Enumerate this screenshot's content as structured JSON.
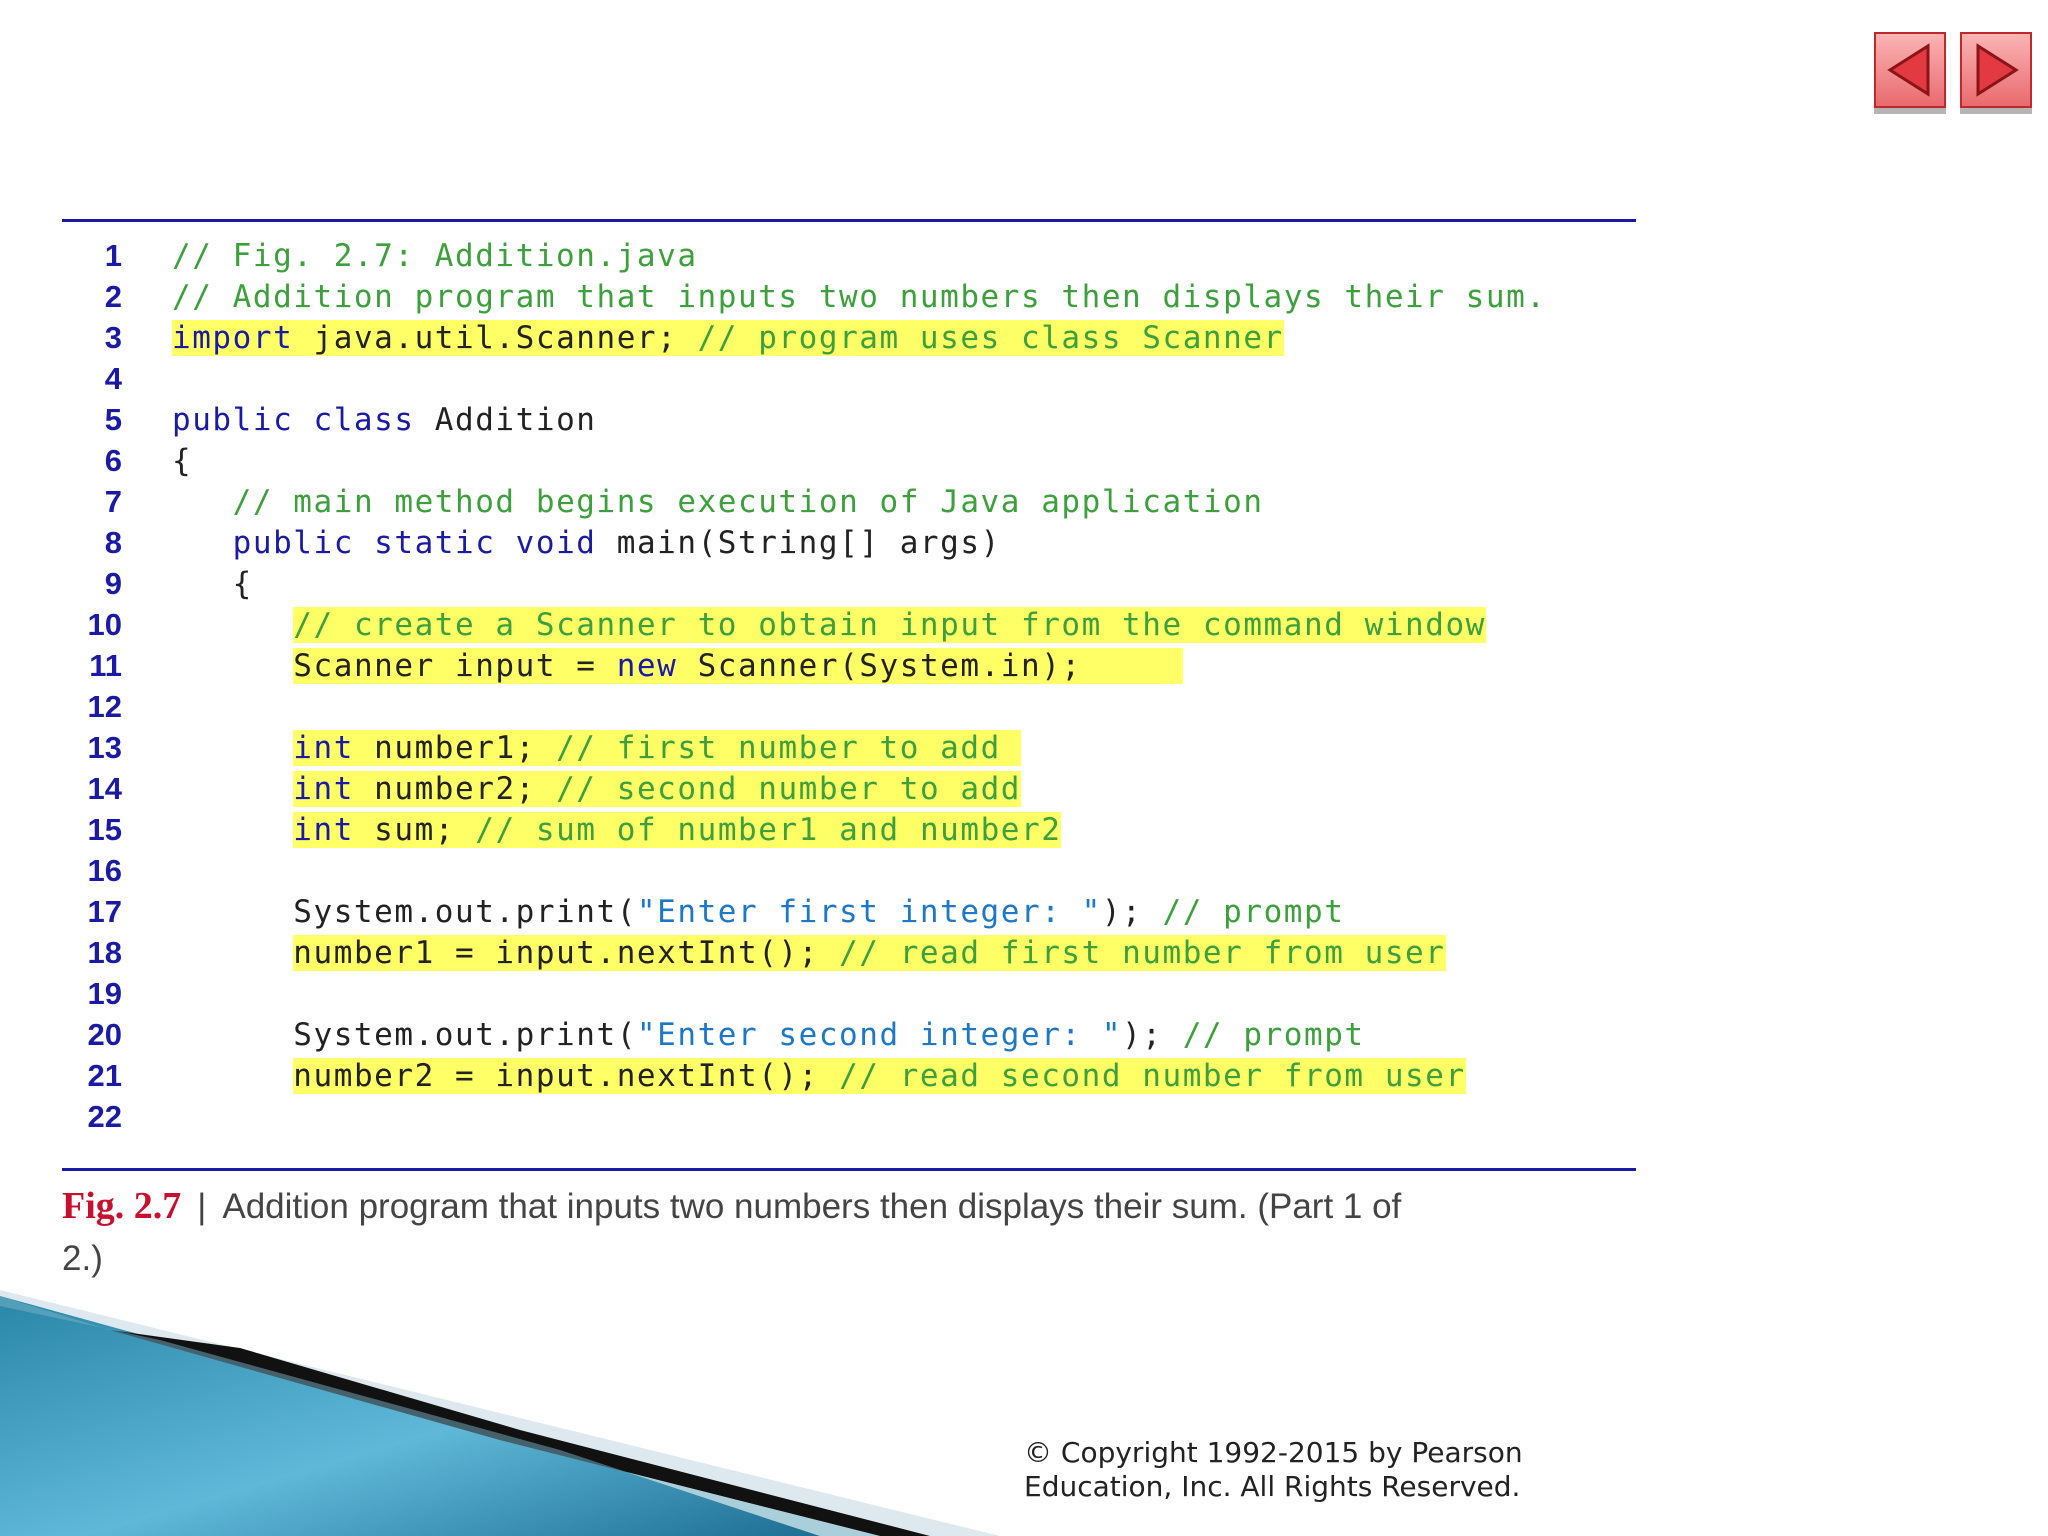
{
  "navigation": {
    "prev_icon": "triangle-left-icon",
    "next_icon": "triangle-right-icon",
    "button_color": "#f08a8d"
  },
  "code": {
    "lines": [
      {
        "n": "1",
        "segs": [
          {
            "t": "// Fig. 2.7: Addition.java",
            "c": "cm"
          }
        ]
      },
      {
        "n": "2",
        "segs": [
          {
            "t": "// Addition program that inputs two numbers then displays their sum.",
            "c": "cm"
          }
        ]
      },
      {
        "n": "3",
        "segs": [
          {
            "t": "import",
            "c": "kw",
            "h": 1
          },
          {
            "t": " java.util.Scanner; ",
            "c": "pl",
            "h": 1
          },
          {
            "t": "// program uses class Scanner",
            "c": "cm",
            "h": 1
          }
        ]
      },
      {
        "n": "4",
        "segs": []
      },
      {
        "n": "5",
        "segs": [
          {
            "t": "public class",
            "c": "kw"
          },
          {
            "t": " Addition",
            "c": "pl"
          }
        ]
      },
      {
        "n": "6",
        "segs": [
          {
            "t": "{",
            "c": "pl"
          }
        ]
      },
      {
        "n": "7",
        "segs": [
          {
            "t": "   ",
            "c": "pl"
          },
          {
            "t": "// main method begins execution of Java application",
            "c": "cm"
          }
        ]
      },
      {
        "n": "8",
        "segs": [
          {
            "t": "   ",
            "c": "pl"
          },
          {
            "t": "public static void",
            "c": "kw"
          },
          {
            "t": " main(String[] args)",
            "c": "pl"
          }
        ]
      },
      {
        "n": "9",
        "segs": [
          {
            "t": "   {",
            "c": "pl"
          }
        ]
      },
      {
        "n": "10",
        "segs": [
          {
            "t": "      ",
            "c": "pl"
          },
          {
            "t": "// create a Scanner to obtain input from the command window",
            "c": "cm",
            "h": 1
          }
        ]
      },
      {
        "n": "11",
        "segs": [
          {
            "t": "      ",
            "c": "pl"
          },
          {
            "t": "Scanner input = ",
            "c": "pl",
            "h": 1
          },
          {
            "t": "new",
            "c": "kw",
            "h": 1
          },
          {
            "t": " Scanner(System.in);     ",
            "c": "pl",
            "h": 1
          }
        ]
      },
      {
        "n": "12",
        "segs": []
      },
      {
        "n": "13",
        "segs": [
          {
            "t": "      ",
            "c": "pl"
          },
          {
            "t": "int",
            "c": "kw",
            "h": 1
          },
          {
            "t": " number1; ",
            "c": "pl",
            "h": 1
          },
          {
            "t": "// first number to add ",
            "c": "cm",
            "h": 1
          }
        ]
      },
      {
        "n": "14",
        "segs": [
          {
            "t": "      ",
            "c": "pl"
          },
          {
            "t": "int",
            "c": "kw",
            "h": 1
          },
          {
            "t": " number2; ",
            "c": "pl",
            "h": 1
          },
          {
            "t": "// second number to add",
            "c": "cm",
            "h": 1
          }
        ]
      },
      {
        "n": "15",
        "segs": [
          {
            "t": "      ",
            "c": "pl"
          },
          {
            "t": "int",
            "c": "kw",
            "h": 1
          },
          {
            "t": " sum; ",
            "c": "pl",
            "h": 1
          },
          {
            "t": "// sum of number1 and number2",
            "c": "cm",
            "h": 1
          }
        ]
      },
      {
        "n": "16",
        "segs": []
      },
      {
        "n": "17",
        "segs": [
          {
            "t": "      System.out.print(",
            "c": "pl"
          },
          {
            "t": "\"Enter first integer: \"",
            "c": "st"
          },
          {
            "t": "); ",
            "c": "pl"
          },
          {
            "t": "// prompt",
            "c": "cm"
          }
        ]
      },
      {
        "n": "18",
        "segs": [
          {
            "t": "      ",
            "c": "pl"
          },
          {
            "t": "number1 = input.nextInt(); ",
            "c": "pl",
            "h": 1
          },
          {
            "t": "// read first number from user",
            "c": "cm",
            "h": 1
          }
        ]
      },
      {
        "n": "19",
        "segs": []
      },
      {
        "n": "20",
        "segs": [
          {
            "t": "      System.out.print(",
            "c": "pl"
          },
          {
            "t": "\"Enter second integer: \"",
            "c": "st"
          },
          {
            "t": "); ",
            "c": "pl"
          },
          {
            "t": "// prompt",
            "c": "cm"
          }
        ]
      },
      {
        "n": "21",
        "segs": [
          {
            "t": "      ",
            "c": "pl"
          },
          {
            "t": "number2 = input.nextInt(); ",
            "c": "pl",
            "h": 1
          },
          {
            "t": "// read second number from user",
            "c": "cm",
            "h": 1
          }
        ]
      },
      {
        "n": "22",
        "segs": []
      }
    ],
    "colors": {
      "keyword": "#1a1aa6",
      "comment": "#3da03d",
      "string": "#1e78c8",
      "plain": "#222222",
      "highlight": "#ffff66",
      "line_number": "#1a1aa6"
    }
  },
  "caption": {
    "label": "Fig. 2.7",
    "separator": "|",
    "text": "Addition program that inputs two numbers then displays their sum. (Part 1 of 2.)",
    "label_color": "#c8102e"
  },
  "footer": {
    "copyright_line1": "© Copyright 1992-2015 by Pearson",
    "copyright_line2": "Education, Inc. All Rights Reserved."
  }
}
